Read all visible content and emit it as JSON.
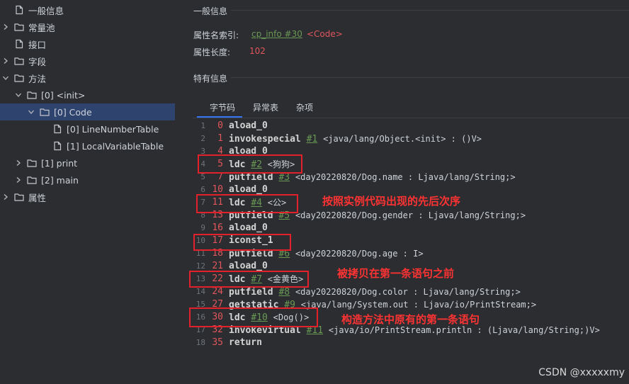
{
  "sidebar": {
    "items": [
      {
        "label": "一般信息",
        "icon": "file-icon",
        "expand": "none"
      },
      {
        "label": "常量池",
        "icon": "folder-icon",
        "expand": "collapsed"
      },
      {
        "label": "接口",
        "icon": "file-icon",
        "expand": "none"
      },
      {
        "label": "字段",
        "icon": "folder-icon",
        "expand": "collapsed"
      },
      {
        "label": "方法",
        "icon": "folder-icon",
        "expand": "expanded"
      },
      {
        "label": "[0] <init>",
        "icon": "folder-icon",
        "expand": "expanded"
      },
      {
        "label": "[0] Code",
        "icon": "folder-icon",
        "expand": "expanded",
        "selected": true
      },
      {
        "label": "[0] LineNumberTable",
        "icon": "file-icon",
        "expand": "none"
      },
      {
        "label": "[1] LocalVariableTable",
        "icon": "file-icon",
        "expand": "none"
      },
      {
        "label": "[1] print",
        "icon": "folder-icon",
        "expand": "collapsed"
      },
      {
        "label": "[2] main",
        "icon": "folder-icon",
        "expand": "collapsed"
      },
      {
        "label": "属性",
        "icon": "folder-icon",
        "expand": "collapsed"
      }
    ]
  },
  "main": {
    "general_title": "一般信息",
    "attr_name_label": "属性名索引:",
    "attr_name_link": "cp_info #30",
    "attr_name_value": "<Code>",
    "attr_len_label": "属性长度:",
    "attr_len_value": "102",
    "specific_title": "特有信息",
    "tabs": [
      {
        "label": "字节码",
        "active": true
      },
      {
        "label": "异常表",
        "active": false
      },
      {
        "label": "杂项",
        "active": false
      }
    ]
  },
  "code": [
    {
      "line": "1",
      "offset": "0",
      "op": "aload_0",
      "ref": "",
      "comment": ""
    },
    {
      "line": "2",
      "offset": "1",
      "op": "invokespecial",
      "ref": "#1",
      "comment": "<java/lang/Object.<init> : ()V>"
    },
    {
      "line": "3",
      "offset": "4",
      "op": "aload_0",
      "ref": "",
      "comment": ""
    },
    {
      "line": "4",
      "offset": "5",
      "op": "ldc",
      "ref": "#2",
      "comment": "<狗狗>"
    },
    {
      "line": "5",
      "offset": "7",
      "op": "putfield",
      "ref": "#3",
      "comment": "<day20220820/Dog.name : Ljava/lang/String;>"
    },
    {
      "line": "6",
      "offset": "10",
      "op": "aload_0",
      "ref": "",
      "comment": ""
    },
    {
      "line": "7",
      "offset": "11",
      "op": "ldc",
      "ref": "#4",
      "comment": "<公>"
    },
    {
      "line": "8",
      "offset": "13",
      "op": "putfield",
      "ref": "#5",
      "comment": "<day20220820/Dog.gender : Ljava/lang/String;>"
    },
    {
      "line": "9",
      "offset": "16",
      "op": "aload_0",
      "ref": "",
      "comment": ""
    },
    {
      "line": "10",
      "offset": "17",
      "op": "iconst_1",
      "ref": "",
      "comment": ""
    },
    {
      "line": "11",
      "offset": "18",
      "op": "putfield",
      "ref": "#6",
      "comment": "<day20220820/Dog.age : I>"
    },
    {
      "line": "12",
      "offset": "21",
      "op": "aload_0",
      "ref": "",
      "comment": ""
    },
    {
      "line": "13",
      "offset": "22",
      "op": "ldc",
      "ref": "#7",
      "comment": "<金黄色>"
    },
    {
      "line": "14",
      "offset": "24",
      "op": "putfield",
      "ref": "#8",
      "comment": "<day20220820/Dog.color : Ljava/lang/String;>"
    },
    {
      "line": "15",
      "offset": "27",
      "op": "getstatic",
      "ref": "#9",
      "comment": "<java/lang/System.out : Ljava/io/PrintStream;>"
    },
    {
      "line": "16",
      "offset": "30",
      "op": "ldc",
      "ref": "#10",
      "comment": "<Dog()>"
    },
    {
      "line": "17",
      "offset": "32",
      "op": "invokevirtual",
      "ref": "#11",
      "comment": "<java/io/PrintStream.println : (Ljava/lang/String;)V>"
    },
    {
      "line": "18",
      "offset": "35",
      "op": "return",
      "ref": "",
      "comment": ""
    }
  ],
  "annotations": {
    "note1": "按照实例代码出现的先后次序",
    "note2": "被拷贝在第一条语句之前",
    "note3": "构造方法中原有的第一条语句"
  },
  "watermark": "CSDN @xxxxxmy",
  "colors": {
    "background": "#2b2d30",
    "selected_row": "#2e436e",
    "accent_tab": "#3574f0",
    "offset_red": "#e0565b",
    "cp_ref_green": "#6a9955",
    "annotation_red": "#e4212b"
  }
}
